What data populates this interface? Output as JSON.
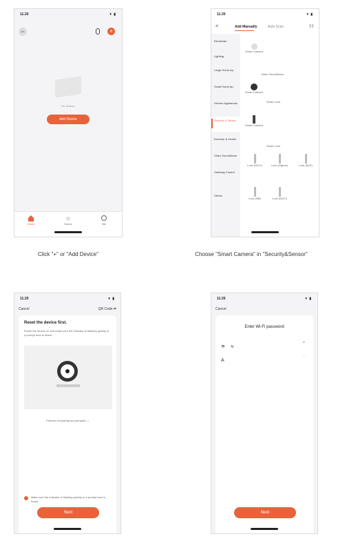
{
  "status_time": "11:20",
  "status_icons": "▾ ▮",
  "screen1": {
    "avatar": "Us",
    "empty_text": "No devices",
    "add_button": "Add Device",
    "tabs": [
      "Home",
      "Scene",
      "Me"
    ],
    "caption": "Click \"+\" or \"Add Device\""
  },
  "screen2": {
    "back": "<",
    "tab_manual": "Add Manually",
    "tab_auto": "Auto Scan",
    "scan": "[–]",
    "categories": [
      "Electrician",
      "Lighting",
      "Large Home Ap.",
      "Small Home Ap.",
      "Kitchen Appliances",
      "Security & Sensor",
      "Exercise & Health",
      "Video Surveillance",
      "Gateway Control",
      "Others"
    ],
    "active_index": 5,
    "section_headers": [
      "Video Surveillance",
      "Smart Lock",
      "Smart Lock"
    ],
    "device_labels": [
      "Smart Camera",
      "Smart Camera",
      "Smart Camera",
      "Lock (Wi-Fi)",
      "Lock (Zigbee)",
      "Lock (BLE)",
      "Lock (NB)",
      "Lock (Wi-Fi)"
    ],
    "caption": "Choose \"Smart Camera\" in \"Security&Sensor\""
  },
  "screen3": {
    "cancel": "Cancel",
    "mode": "QR Code ⇄",
    "title": "Reset the device first.",
    "description": "Power the device on and make sure the indicator is flashing quickly or a prompt tone is heard.",
    "link": "Perform net pairing as prompted. >",
    "confirm": "Make sure the indicator is flashing quickly or a prompt tone is heard",
    "next": "Next"
  },
  "screen4": {
    "cancel": "Cancel",
    "title": "Enter Wi-Fi password",
    "wifi_symbol": "≋",
    "wifi_name": "N",
    "pw_symbol": "A",
    "next": "Next"
  },
  "colors": {
    "accent": "#e8633a"
  }
}
